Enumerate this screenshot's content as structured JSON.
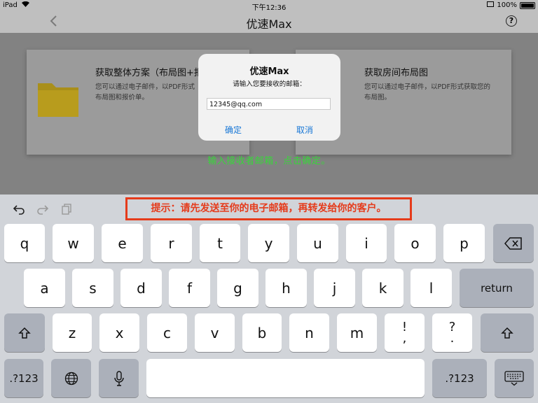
{
  "status_bar": {
    "device": "iPad",
    "wifi_icon": "wifi-icon",
    "time": "下午12:36",
    "battery": "100%"
  },
  "nav": {
    "title": "优速Max",
    "back_icon": "chevron-left-icon",
    "help_icon": "help-circle-icon",
    "help_glyph": "?"
  },
  "cards": [
    {
      "title": "获取整体方案（布局图+报",
      "desc_line1": "您可以通过电子邮件，以PDF形式",
      "desc_line2": "布局图和报价单。"
    },
    {
      "title": "获取房间布局图",
      "desc_line1": "您可以通过电子邮件，以PDF形式获取您的",
      "desc_line2": "布局图。"
    }
  ],
  "hint_green": "输入接收者邮箱，点击确定。",
  "alert": {
    "title": "优速Max",
    "message": "请输入您要接收的邮箱：",
    "email_value": "12345@qq.com",
    "confirm": "确定",
    "cancel": "取消"
  },
  "keyboard": {
    "banner": "提示：请先发送至你的电子邮箱，再转发给你的客户。",
    "toolbar": {
      "undo_icon": "undo-icon",
      "redo_icon": "redo-icon",
      "paste_icon": "clipboard-icon"
    },
    "row1": [
      "q",
      "w",
      "e",
      "r",
      "t",
      "y",
      "u",
      "i",
      "o",
      "p"
    ],
    "row2": [
      "a",
      "s",
      "d",
      "f",
      "g",
      "h",
      "j",
      "k",
      "l"
    ],
    "row3": [
      "z",
      "x",
      "c",
      "v",
      "b",
      "n",
      "m"
    ],
    "return_label": "return",
    "excl_top": "!",
    "excl_bottom": ",",
    "quest_top": "?",
    "quest_bottom": ".",
    "numbers_label": ".?123",
    "icons": {
      "delete": "backspace-icon",
      "shift": "shift-icon",
      "globe": "globe-icon",
      "mic": "microphone-icon",
      "hide": "keyboard-hide-icon"
    }
  }
}
